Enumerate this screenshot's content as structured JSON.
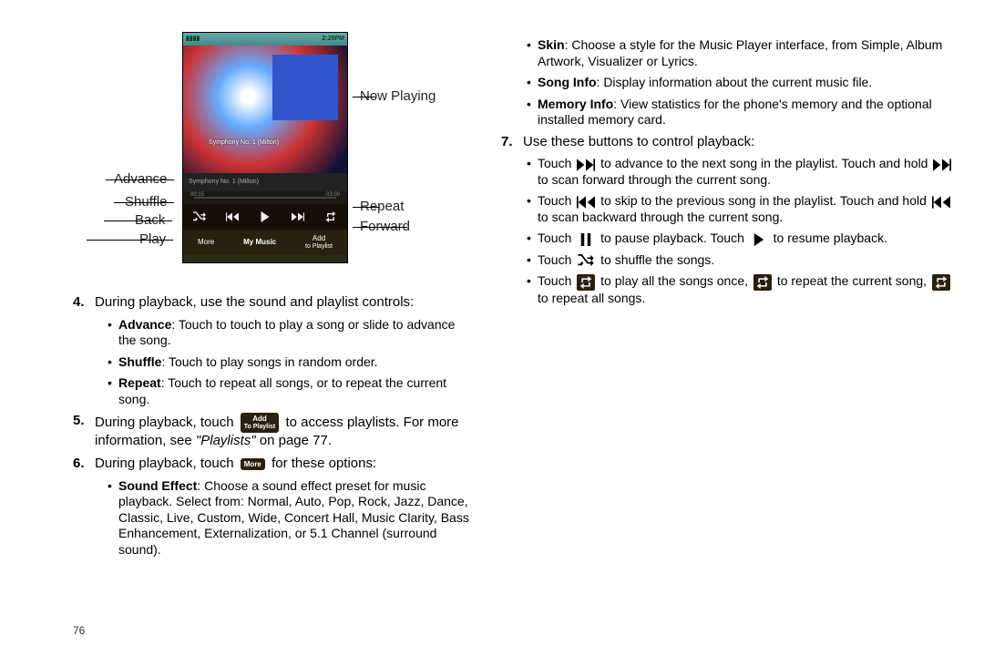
{
  "page_number": "76",
  "figure": {
    "statusbar_left": "▮▮▮▮",
    "statusbar_time": "2:25PM",
    "album_tag": "Symphony No. 1 (Milton)",
    "track_title": "Symphony No. 1 (Milton)",
    "track_pos": "00:15",
    "track_dur": "03:00",
    "softkey_more": "More",
    "softkey_music": "My Music",
    "softkey_add1": "Add",
    "softkey_add2": "to Playlist",
    "callouts": {
      "now_playing": "Now Playing",
      "advance": "Advance",
      "shuffle": "Shuffle",
      "back": "Back",
      "play": "Play",
      "repeat": "Repeat",
      "forward": "Forward"
    }
  },
  "step4": {
    "num": "4.",
    "text": "During playback, use the sound and playlist controls:",
    "bullets": {
      "advance_b": "Advance",
      "advance_t": ": Touch to touch to play a song or slide to advance the song.",
      "shuffle_b": "Shuffle",
      "shuffle_t": ": Touch to play songs in random order.",
      "repeat_b": "Repeat",
      "repeat_t": ": Touch to repeat all songs, or to repeat the current song."
    }
  },
  "step5": {
    "num": "5.",
    "t1": "During playback, touch",
    "btn1": "Add",
    "btn2": "To Playlist",
    "t2": "to access playlists. For more information, see",
    "t3": "\"Playlists\"",
    "t4": " on page 77."
  },
  "step6": {
    "num": "6.",
    "t1": "During playback, touch",
    "btn": "More",
    "t2": "for these options:",
    "bullets": {
      "sound_b": "Sound Effect",
      "sound_t": ": Choose a sound effect preset for music playback. Select from: Normal, Auto, Pop, Rock, Jazz, Dance, Classic, Live, Custom, Wide, Concert Hall, Music Clarity, Bass Enhancement, Externalization, or 5.1 Channel (surround sound)."
    }
  },
  "right_pre_bullets": {
    "skin_b": "Skin",
    "skin_t": ": Choose a style for the Music Player interface, from Simple, Album Artwork, Visualizer or Lyrics.",
    "song_b": "Song Info",
    "song_t": ": Display information about the current music file.",
    "mem_b": "Memory Info",
    "mem_t": ": View statistics for the phone's memory and the optional installed memory card."
  },
  "step7": {
    "num": "7.",
    "text": "Use these buttons to control playback:",
    "bullets": {
      "fwd1": "Touch",
      "fwd2": "to advance to the next song in the playlist. Touch and hold",
      "fwd3": "to scan forward through the current song.",
      "back1": "Touch",
      "back2": "to skip to the previous song in the playlist. Touch and hold",
      "back3": "to scan backward through the current song.",
      "pause1": "Touch",
      "pause2": "to pause playback. Touch",
      "pause3": "to resume playback.",
      "shuf1": "Touch",
      "shuf2": "to shuffle the songs.",
      "rep1": "Touch",
      "rep2": "to play all the songs once,",
      "rep3": "to repeat the current song,",
      "rep4": "to repeat all songs."
    }
  }
}
